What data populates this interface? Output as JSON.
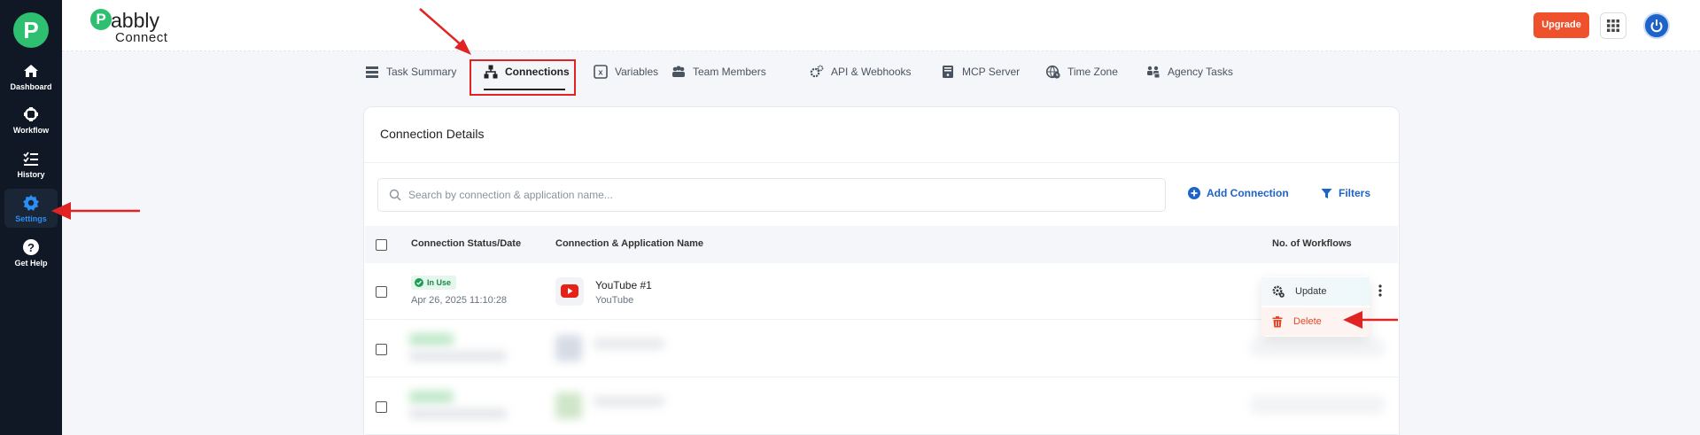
{
  "sidebar": {
    "logo": "P",
    "items": [
      {
        "label": "Dashboard",
        "icon": "home-icon"
      },
      {
        "label": "Workflow",
        "icon": "workflow-icon"
      },
      {
        "label": "History",
        "icon": "history-icon"
      },
      {
        "label": "Settings",
        "icon": "gear-icon"
      },
      {
        "label": "Get Help",
        "icon": "help-icon"
      }
    ]
  },
  "header": {
    "brand_mark": "P",
    "brand_name": "abbly",
    "brand_sub": "Connect",
    "upgrade_label": "Upgrade"
  },
  "tabs": [
    {
      "label": "Task Summary",
      "icon": "task-summary-icon"
    },
    {
      "label": "Connections",
      "icon": "connections-icon",
      "active": true
    },
    {
      "label": "Variables",
      "icon": "variables-icon"
    },
    {
      "label": "Team Members",
      "icon": "team-icon"
    },
    {
      "label": "API & Webhooks",
      "icon": "api-gear-icon"
    },
    {
      "label": "MCP Server",
      "icon": "server-icon"
    },
    {
      "label": "Time Zone",
      "icon": "globe-clock-icon"
    },
    {
      "label": "Agency Tasks",
      "icon": "agency-icon"
    }
  ],
  "card": {
    "title": "Connection Details",
    "search_placeholder": "Search by connection & application name...",
    "add_connection_label": "Add Connection",
    "filters_label": "Filters"
  },
  "table": {
    "headers": [
      "Connection Status/Date",
      "Connection & Application Name",
      "No. of Workflows"
    ],
    "rows": [
      {
        "status": "In Use",
        "date": "Apr 26, 2025 11:10:28",
        "connection_name": "YouTube #1",
        "app_name": "YouTube",
        "app_icon": "youtube-icon"
      }
    ]
  },
  "dropdown": {
    "update_label": "Update",
    "delete_label": "Delete"
  },
  "colors": {
    "sidebar_bg": "#101826",
    "accent_blue": "#1e64c8",
    "brand_green": "#2fbf71",
    "upgrade_orange": "#f0512d",
    "annotation_red": "#e02424",
    "status_green": "#178a46"
  }
}
